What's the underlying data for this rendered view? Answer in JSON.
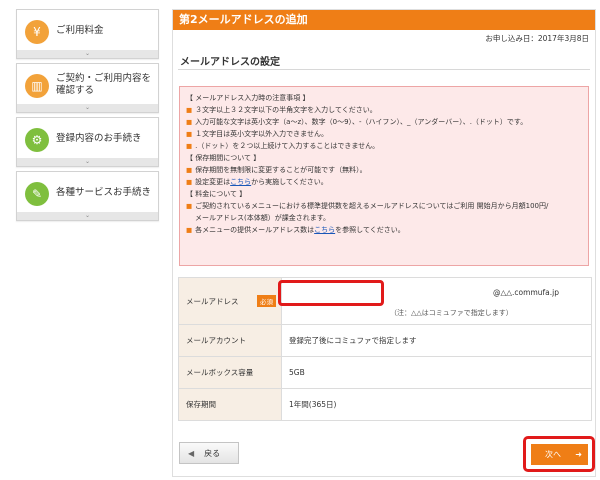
{
  "sidebar": {
    "items": [
      {
        "label": "ご利用料金",
        "icon": "yen-icon",
        "glyph": "¥"
      },
      {
        "label": "ご契約・ご利用内容を確認する",
        "icon": "book-icon",
        "glyph": "▥"
      },
      {
        "label": "登録内容のお手続き",
        "icon": "gear-icon",
        "glyph": "⚙"
      },
      {
        "label": "各種サービスお手続き",
        "icon": "document-edit-icon",
        "glyph": "✎"
      }
    ],
    "chevron": "⌄"
  },
  "main": {
    "title": "第2メールアドレスの追加",
    "application_date": "お申し込み日：2017年3月8日",
    "section_title": "メールアドレスの設定",
    "notice": {
      "rows": [
        {
          "type": "head",
          "text": "【 メールアドレス入力時の注意事項 】"
        },
        {
          "type": "bullet",
          "text": "３文字以上３２文字以下の半角文字を入力してください。"
        },
        {
          "type": "bullet",
          "text": "入力可能な文字は英小文字（a〜z）、数字（0〜9）、-（ハイフン）、_（アンダーバー）、.（ドット）です。"
        },
        {
          "type": "bullet",
          "text": "１文字目は英小文字以外入力できません。"
        },
        {
          "type": "bullet",
          "text": ".（ドット）を２つ以上続けて入力することはできません。"
        },
        {
          "type": "head",
          "text": "【 保存期間について 】"
        },
        {
          "type": "bullet",
          "text": "保存期間を無制限に変更することが可能です（無料）。"
        },
        {
          "type": "link",
          "before": "設定変更は",
          "link": "こちら",
          "after": "から実施してください。"
        },
        {
          "type": "head",
          "text": "【 料金について 】"
        },
        {
          "type": "bullet",
          "text": "ご契約されているメニューにおける標準提供数を超えるメールアドレスについてはご利用 開始月から月額100円/"
        },
        {
          "type": "cont",
          "text": "メールアドレス(本体額）が課金されます。"
        },
        {
          "type": "link",
          "before": "各メニューの提供メールアドレス数は",
          "link": "こちら",
          "after": "を参照してください。"
        }
      ]
    },
    "form": {
      "email_label": "メールアドレス",
      "required_badge": "必須",
      "email_value": "",
      "email_domain": "@△△.commufa.jp",
      "email_note": "（注：△△はコミュファで指定します）",
      "account_label": "メールアカウント",
      "account_value": "登録完了後にコミュファで指定します",
      "capacity_label": "メールボックス容量",
      "capacity_value": "5GB",
      "retention_label": "保存期間",
      "retention_value": "1年間(365日)"
    },
    "buttons": {
      "back_label": "戻る",
      "next_label": "次へ"
    }
  },
  "colors": {
    "accent": "#ef7e16",
    "highlight": "#e11a1a",
    "notice_bg": "#fde9e9",
    "link": "#1a57b8"
  }
}
